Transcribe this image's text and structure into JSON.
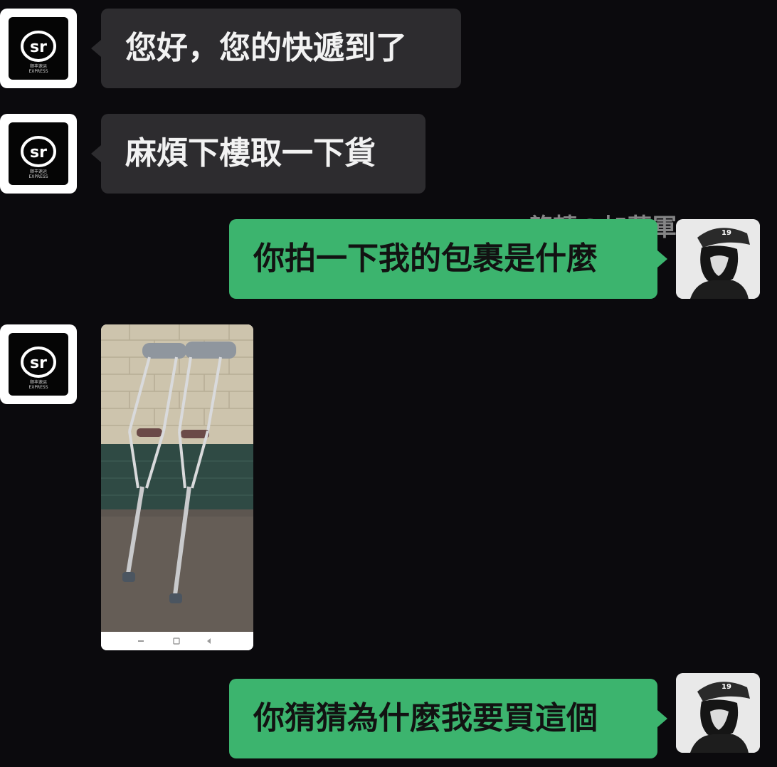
{
  "watermark": "綮轉@加藤軍",
  "sender_logo": {
    "mark": "SF",
    "sub_line1": "顺丰速运",
    "sub_line2": "EXPRESS"
  },
  "messages": [
    {
      "side": "in",
      "type": "text",
      "text": "您好，您的快遞到了"
    },
    {
      "side": "in",
      "type": "text",
      "text": "麻煩下樓取一下貨"
    },
    {
      "side": "out",
      "type": "text",
      "text": "你拍一下我的包裹是什麼"
    },
    {
      "side": "in",
      "type": "image",
      "icon": "crutches-photo"
    },
    {
      "side": "out",
      "type": "text",
      "text": "你猜猜為什麼我要買這個"
    }
  ],
  "colors": {
    "background": "#0b0a0d",
    "incoming_bubble": "#2d2c2f",
    "outgoing_bubble": "#3cb46e"
  }
}
